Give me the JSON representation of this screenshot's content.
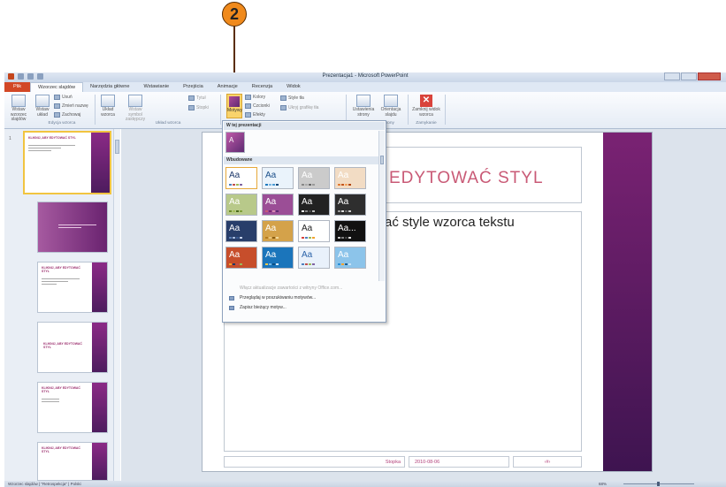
{
  "callout": {
    "number": "2"
  },
  "window": {
    "title": "Prezentacja1 - Microsoft PowerPoint"
  },
  "tabs": [
    "Plik",
    "Wzorzec slajdów",
    "Narzędzia główne",
    "Wstawianie",
    "Przejścia",
    "Animacje",
    "Recenzja",
    "Widok"
  ],
  "ribbon": {
    "btn_insert_master": "Wstaw wzorzec slajdów",
    "btn_insert_layout": "Wstaw układ",
    "small_delete": "Usuń",
    "small_rename": "Zmień nazwę",
    "small_preserve": "Zachowaj",
    "group_edit_master": "Edycja wzorca",
    "btn_master_layout": "Układ wzorca",
    "btn_insert_placeholder": "Wstaw symbol zastępczy",
    "chk_title": "Tytuł",
    "chk_footers": "Stopki",
    "group_master_layout": "Układ wzorca",
    "btn_themes": "Motywy",
    "small_colors": "Kolory",
    "small_fonts": "Czcionki",
    "small_effects": "Efekty",
    "small_bg_styles": "Style tła",
    "chk_hide_bg": "Ukryj grafikę tła",
    "group_themes_label": "Wszystkie motywy",
    "btn_page_setup": "Ustawienia strony",
    "btn_orientation": "Orientacja slajdu",
    "group_page_setup": "Ustawienia strony",
    "btn_close_master": "Zamknij widok wzorca",
    "group_close": "Zamykanie"
  },
  "thumbnails": {
    "first_number": "1",
    "master_title": "KLIKNIJ, ABY EDYTOWAĆ STYL",
    "layout_title": "KLIKNIJ, ABY EDYTOWAĆ STYL"
  },
  "slide": {
    "title": "EDYTOWAĆ STYL",
    "body": "ać style wzorca tekstu",
    "footer": "Stopka",
    "date": "2010-08-06",
    "page": "‹#›"
  },
  "dropdown": {
    "section_current": "W tej prezentacji",
    "section_builtin": "Wbudowane",
    "themes": [
      {
        "label": "Aa",
        "bg": "#ffffff",
        "fg": "#1f3a6b",
        "accent": [
          "#4f81bd",
          "#c0504d",
          "#9bbb59",
          "#8064a2"
        ]
      },
      {
        "label": "Aa",
        "bg": "#eaf3fb",
        "fg": "#1b4f8a",
        "accent": [
          "#1f7abf",
          "#78b4e0",
          "#4a9bd4",
          "#14497a"
        ]
      },
      {
        "label": "Aa",
        "bg": "#cbcbcb",
        "fg": "#ffffff",
        "accent": [
          "#888888",
          "#aaaaaa",
          "#666666",
          "#999999"
        ]
      },
      {
        "label": "Aa",
        "bg": "#f2dcc4",
        "fg": "#ffffff",
        "accent": [
          "#e07b34",
          "#c4551c",
          "#f4a45c",
          "#b04410"
        ]
      },
      {
        "label": "Aa",
        "bg": "#b8c98a",
        "fg": "#ffffff",
        "accent": [
          "#6b8c2a",
          "#a3bf5a",
          "#4a6a1a",
          "#7fa03a"
        ]
      },
      {
        "label": "Aa",
        "bg": "#9b4e96",
        "fg": "#ffffff",
        "accent": [
          "#c95a76",
          "#7a2273",
          "#d78ab1",
          "#5e2a72"
        ]
      },
      {
        "label": "Aa",
        "bg": "#222222",
        "fg": "#ffffff",
        "accent": [
          "#f0f0f0",
          "#888888",
          "#444444",
          "#bbbbbb"
        ]
      },
      {
        "label": "Aa",
        "bg": "#2e2e2e",
        "fg": "#ffffff",
        "accent": [
          "#999999",
          "#dddddd",
          "#666666",
          "#cccccc"
        ]
      },
      {
        "label": "Aa",
        "bg": "#283e6a",
        "fg": "#ffffff",
        "accent": [
          "#5d7fb5",
          "#a6bbde",
          "#3b5a91",
          "#c7d3ea"
        ]
      },
      {
        "label": "Aa",
        "bg": "#d4a24a",
        "fg": "#ffffff",
        "accent": [
          "#b37a1f",
          "#e8c47a",
          "#8a5d12",
          "#f2d99c"
        ]
      },
      {
        "label": "Aa",
        "bg": "#ffffff",
        "fg": "#222222",
        "accent": [
          "#d9433b",
          "#4f81bd",
          "#9bbb59",
          "#f2a32e"
        ]
      },
      {
        "label": "Aa...",
        "bg": "#111111",
        "fg": "#ffffff",
        "accent": [
          "#c0c0c0",
          "#7f7f7f",
          "#404040",
          "#e0e0e0"
        ]
      },
      {
        "label": "Aa",
        "bg": "#c74e2b",
        "fg": "#ffffff",
        "accent": [
          "#f2a32e",
          "#1f3a6b",
          "#c0504d",
          "#9bbb59"
        ]
      },
      {
        "label": "Aa",
        "bg": "#1b75bb",
        "fg": "#ffffff",
        "accent": [
          "#f7c948",
          "#77b8e6",
          "#0f4e82",
          "#d9e9f6"
        ]
      },
      {
        "label": "Aa",
        "bg": "#e9f1fb",
        "fg": "#2a62a8",
        "accent": [
          "#4f81bd",
          "#c0504d",
          "#9bbb59",
          "#8064a2"
        ]
      },
      {
        "label": "Aa",
        "bg": "#8cc4ea",
        "fg": "#ffffff",
        "accent": [
          "#2a8fd6",
          "#f2a32e",
          "#1c5f94",
          "#c6e2f6"
        ]
      }
    ],
    "menu": [
      {
        "label": "Włącz aktualizacje zawartości z witryny Office.com...",
        "disabled": true
      },
      {
        "label": "Przeglądaj w poszukiwaniu motywów...",
        "disabled": false
      },
      {
        "label": "Zapisz bieżący motyw...",
        "disabled": false
      }
    ]
  },
  "statusbar": {
    "view": "Wzorzec slajdów",
    "theme": "Retrospekcja",
    "lang": "Polski",
    "zoom": "68%"
  },
  "colors": {
    "accent_purple": "#7a2273",
    "title_pink": "#c95a76",
    "file_tab": "#d24726",
    "highlight": "#f9d36b"
  }
}
